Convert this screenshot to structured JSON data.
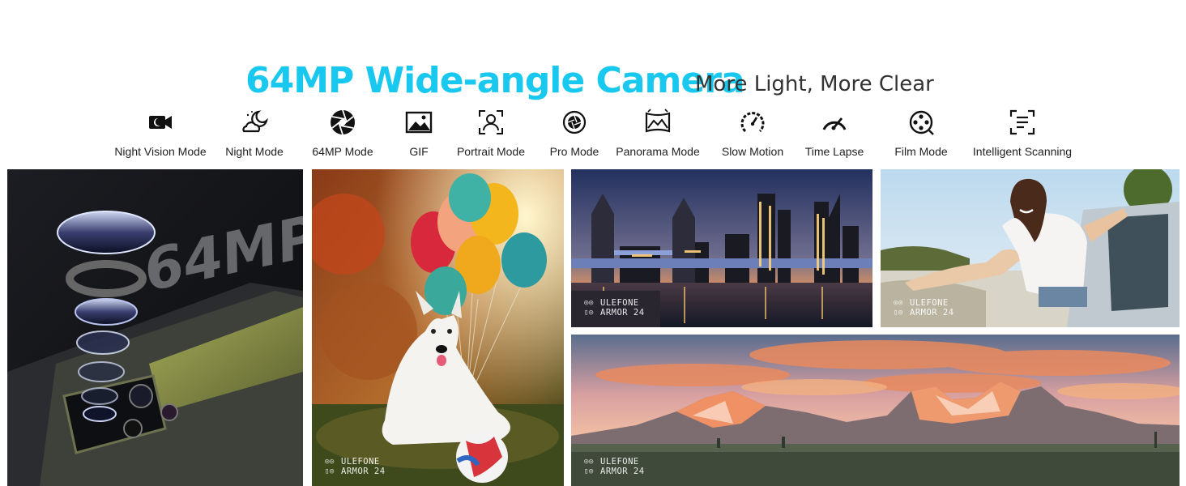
{
  "headline": {
    "title": "64MP Wide-angle Camera",
    "subtitle": "More Light, More Clear"
  },
  "accent_color": "#19c8ee",
  "modes": [
    {
      "label": "Night Vision Mode",
      "icon": "video-camera-icon"
    },
    {
      "label": "Night Mode",
      "icon": "moon-cloud-icon"
    },
    {
      "label": "64MP Mode",
      "icon": "aperture-icon"
    },
    {
      "label": "GIF",
      "icon": "image-icon"
    },
    {
      "label": "Portrait Mode",
      "icon": "portrait-icon"
    },
    {
      "label": "Pro Mode",
      "icon": "shutter-icon"
    },
    {
      "label": "Panorama Mode",
      "icon": "panorama-icon"
    },
    {
      "label": "Slow Motion",
      "icon": "slow-motion-icon"
    },
    {
      "label": "Time Lapse",
      "icon": "speedometer-icon"
    },
    {
      "label": "Film Mode",
      "icon": "film-reel-icon"
    },
    {
      "label": "Intelligent Scanning",
      "icon": "scan-icon"
    }
  ],
  "panels": {
    "phone": {
      "text": "64MP"
    },
    "dog": {
      "wm_brand": "ULEFONE",
      "wm_model": "ARMOR 24"
    },
    "city": {
      "wm_brand": "ULEFONE",
      "wm_model": "ARMOR 24"
    },
    "woman": {
      "wm_brand": "ULEFONE",
      "wm_model": "ARMOR 24"
    },
    "mountains": {
      "wm_brand": "ULEFONE",
      "wm_model": "ARMOR 24"
    }
  }
}
